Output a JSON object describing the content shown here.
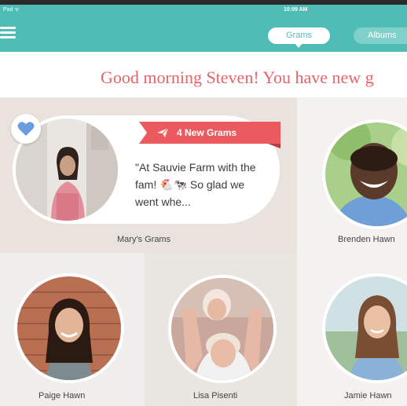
{
  "status_bar": {
    "left": "Pad ᯤ",
    "time": "10:09 AM"
  },
  "header": {
    "menu_icon": "hamburger-menu-icon",
    "tabs": [
      {
        "label": "Grams",
        "active": true
      },
      {
        "label": "Albums",
        "active": false
      }
    ]
  },
  "greeting": "Good morning Steven! You have new g",
  "featured": {
    "badge": "4 New Grams",
    "badge_icon": "paper-plane-icon",
    "favorite_icon": "heart-icon",
    "snippet": "\"At Sauvie Farm with the fam! 🐔🐄 So glad we went whe...",
    "name": "Mary's Grams"
  },
  "contacts": [
    {
      "name": "Brenden Hawn"
    },
    {
      "name": "Paige Hawn"
    },
    {
      "name": "Lisa Pisenti"
    },
    {
      "name": "Jamie Hawn"
    }
  ],
  "colors": {
    "header": "#4fbdb6",
    "accent": "#e8636a",
    "ribbon": "#ea5a5f",
    "heart": "#6b9be0"
  }
}
